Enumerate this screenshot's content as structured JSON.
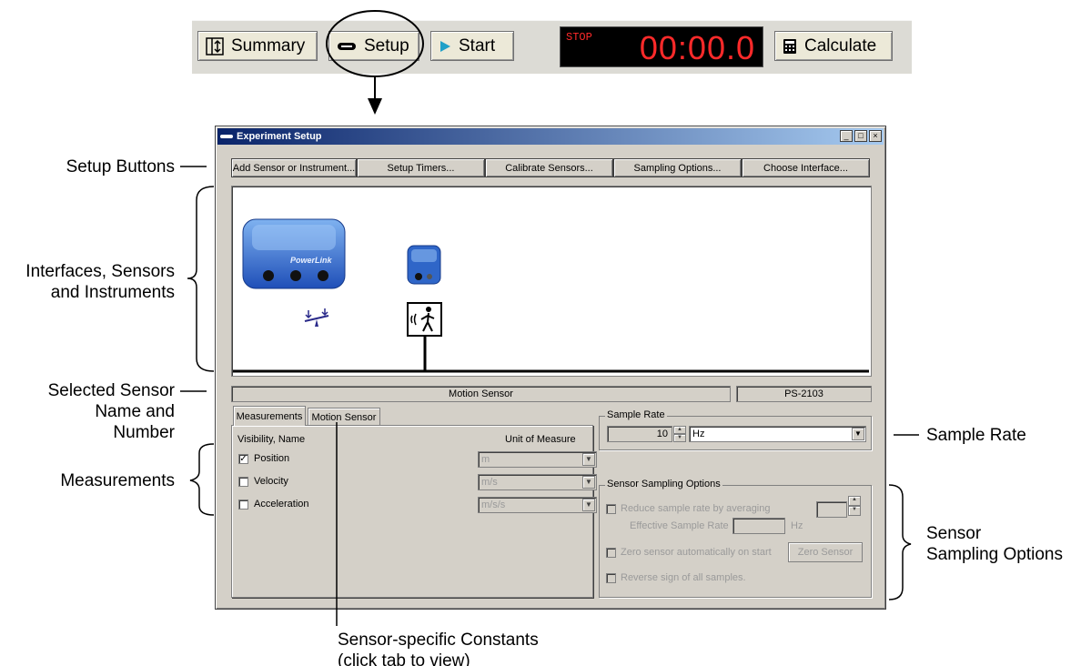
{
  "toolbar": {
    "summary_label": "Summary",
    "setup_label": "Setup",
    "start_label": "Start",
    "timer_state": "STOP",
    "timer_value": "00:00.0",
    "calculate_label": "Calculate"
  },
  "annotations": {
    "setup_buttons": "Setup Buttons",
    "interfaces_line1": "Interfaces, Sensors",
    "interfaces_line2": "and Instruments",
    "selected_line1": "Selected Sensor",
    "selected_line2": "Name and",
    "selected_line3": "Number",
    "measurements": "Measurements",
    "sample_rate": "Sample Rate",
    "sso_line1": "Sensor",
    "sso_line2": "Sampling Options",
    "constants_line1": "Sensor-specific Constants",
    "constants_line2": "(click tab to view)"
  },
  "window": {
    "title": "Experiment Setup",
    "setup_buttons": [
      "Add Sensor or Instrument...",
      "Setup Timers...",
      "Calibrate Sensors...",
      "Sampling Options...",
      "Choose Interface..."
    ],
    "interface_label": "PowerLink",
    "sensor_name": "Motion Sensor",
    "sensor_number": "PS-2103",
    "tabs": [
      "Measurements",
      "Motion Sensor"
    ],
    "measurements": {
      "col_visibility": "Visibility, Name",
      "col_unit": "Unit of Measure",
      "rows": [
        {
          "name": "Position",
          "checked": "✓",
          "unit": "m"
        },
        {
          "name": "Velocity",
          "checked": "",
          "unit": "m/s"
        },
        {
          "name": "Acceleration",
          "checked": "",
          "unit": "m/s/s"
        }
      ]
    },
    "sample_rate": {
      "title": "Sample Rate",
      "value": "10",
      "unit": "Hz"
    },
    "sampling_options": {
      "title": "Sensor Sampling Options",
      "reduce": "Reduce sample rate by averaging",
      "effective": "Effective Sample Rate",
      "effective_unit": "Hz",
      "zero_auto": "Zero sensor automatically on start",
      "zero_button": "Zero Sensor",
      "reverse": "Reverse sign of all samples."
    }
  }
}
